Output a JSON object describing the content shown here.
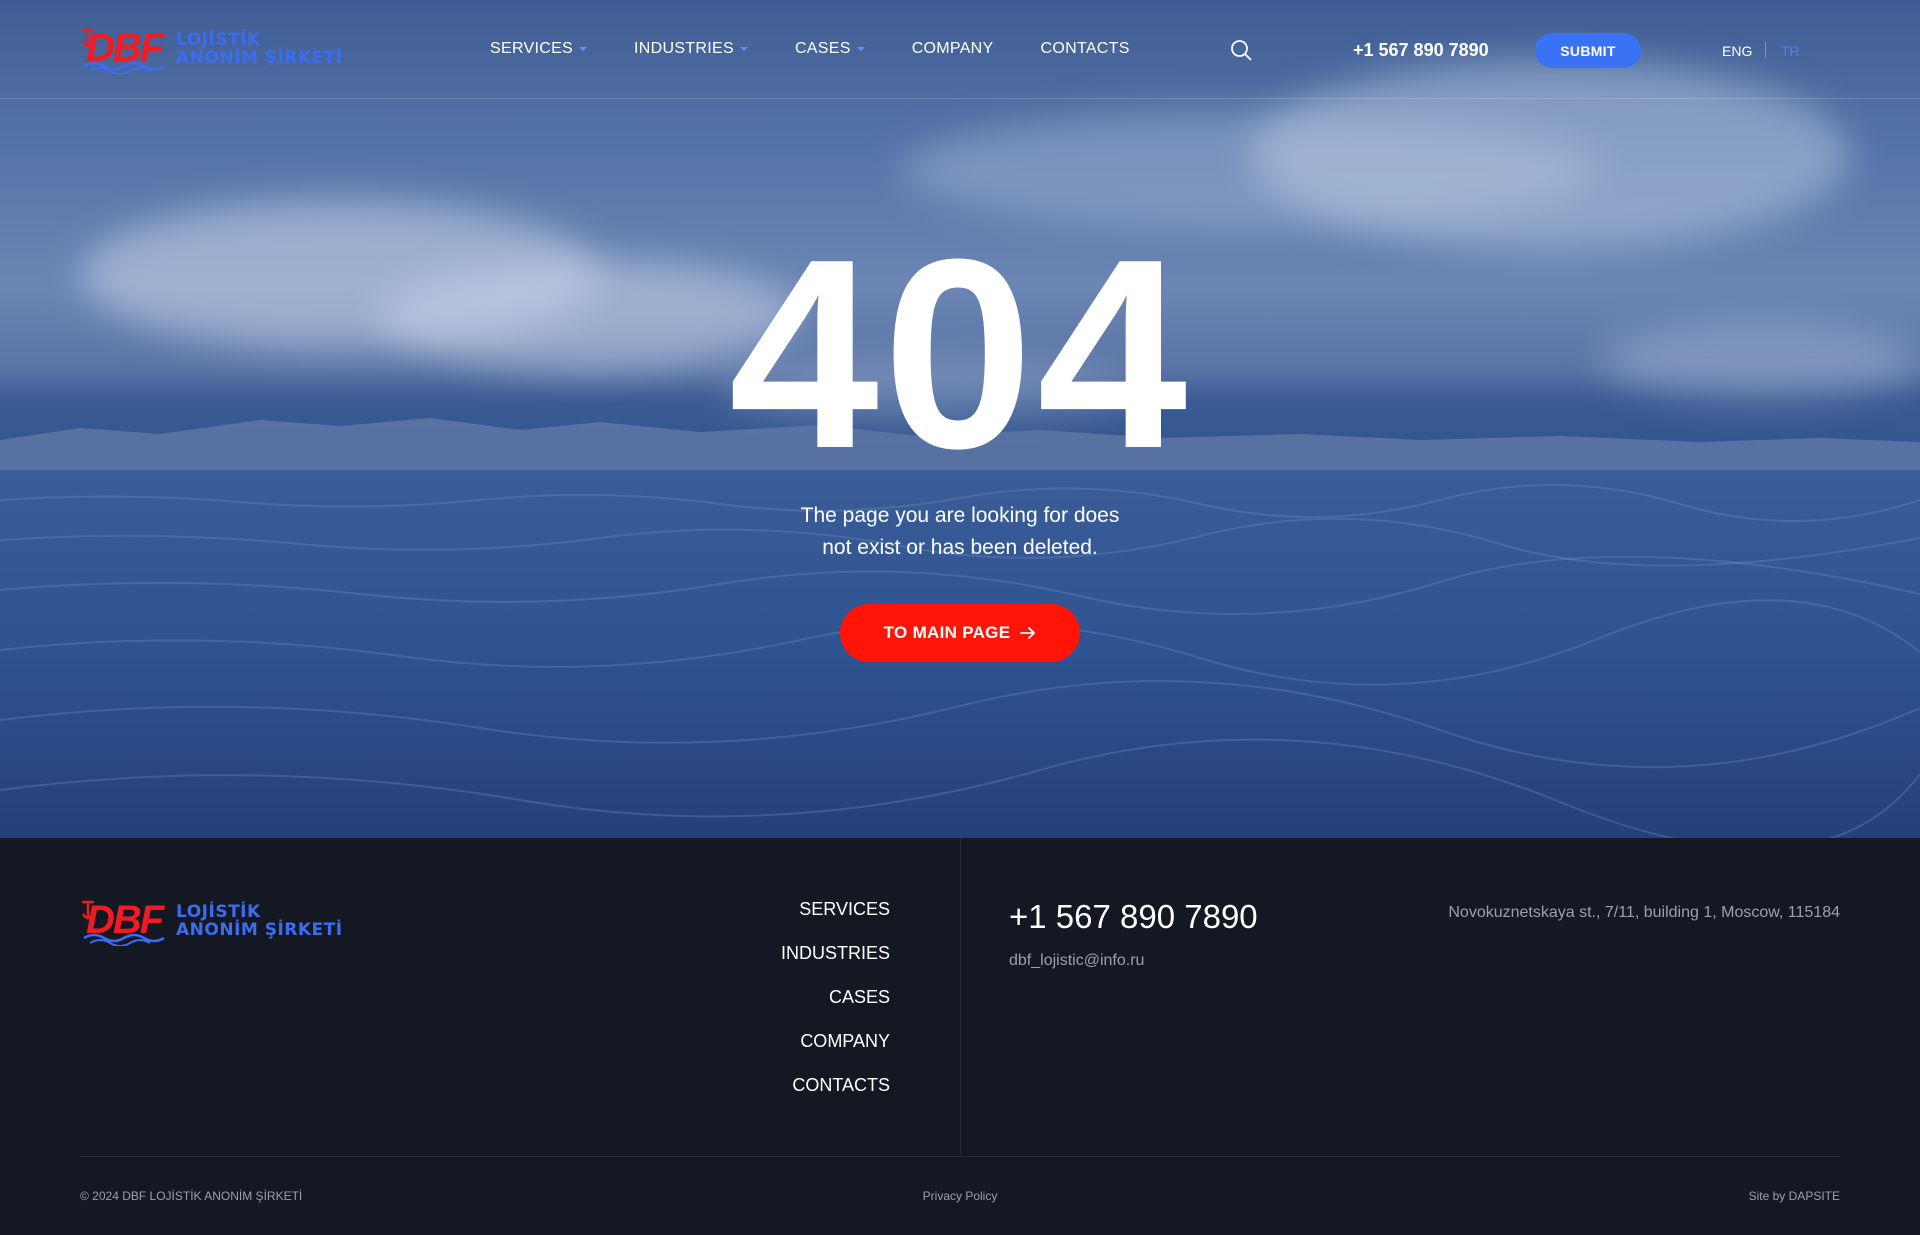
{
  "brand": {
    "logo_mark": "DBF",
    "logo_line1": "LOJİSTİK",
    "logo_line2": "ANONİM ŞİRKETİ",
    "colors": {
      "red": "#ee1d23",
      "blue": "#3c6cf2"
    }
  },
  "header": {
    "nav": [
      {
        "label": "SERVICES",
        "has_dropdown": true
      },
      {
        "label": "INDUSTRIES",
        "has_dropdown": true
      },
      {
        "label": "CASES",
        "has_dropdown": true
      },
      {
        "label": "COMPANY",
        "has_dropdown": false
      },
      {
        "label": "CONTACTS",
        "has_dropdown": false
      }
    ],
    "search_icon": "search-icon",
    "phone": "+1 567 890 7890",
    "submit_label": "SUBMIT",
    "languages": {
      "eng": "ENG",
      "tr": "TR",
      "active": "ENG"
    }
  },
  "error": {
    "code": "404",
    "message_line1": "The page you are looking for does",
    "message_line2": "not exist or has been deleted.",
    "button_label": "TO MAIN PAGE",
    "button_icon": "arrow-right-icon",
    "button_color": "#ff1407"
  },
  "footer": {
    "nav": [
      "SERVICES",
      "INDUSTRIES",
      "CASES",
      "COMPANY",
      "CONTACTS"
    ],
    "phone": "+1 567 890 7890",
    "email": "dbf_lojistic@info.ru",
    "address": "Novokuznetskaya st., 7/11, building 1, Moscow, 115184",
    "copyright": "© 2024 DBF LOJİSTİK ANONİM ŞİRKETİ",
    "privacy": "Privacy Policy",
    "site_by": "Site by DAPSITE"
  }
}
